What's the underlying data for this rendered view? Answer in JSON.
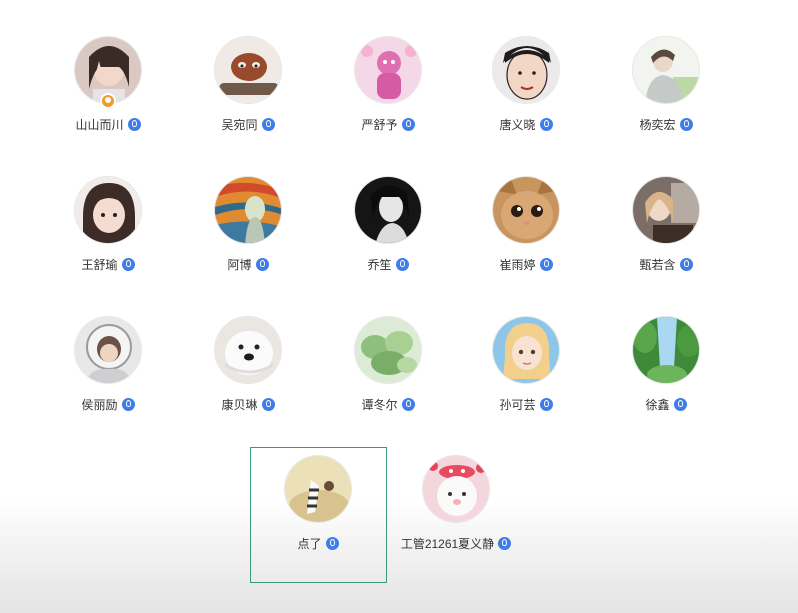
{
  "members": [
    {
      "name": "山山而川",
      "badge": true
    },
    {
      "name": "吴宛同",
      "badge": false
    },
    {
      "name": "严舒予",
      "badge": false
    },
    {
      "name": "唐义晓",
      "badge": false
    },
    {
      "name": "杨奕宏",
      "badge": false
    },
    {
      "name": "王舒瑜",
      "badge": false
    },
    {
      "name": "阿博",
      "badge": false
    },
    {
      "name": "乔笙",
      "badge": false
    },
    {
      "name": "崔雨婷",
      "badge": false
    },
    {
      "name": "甄若含",
      "badge": false
    },
    {
      "name": "侯丽励",
      "badge": false
    },
    {
      "name": "康贝琳",
      "badge": false
    },
    {
      "name": "谭冬尔",
      "badge": false
    },
    {
      "name": "孙可芸",
      "badge": false
    },
    {
      "name": "徐鑫",
      "badge": false
    },
    {
      "name": "点了",
      "badge": false,
      "selected": true
    },
    {
      "name": "工管21261夏义静",
      "badge": false
    }
  ],
  "icons": {
    "verified": "verified-badge-icon",
    "host": "host-badge-icon"
  },
  "colors": {
    "verified": "#3f7ee8",
    "selection_border": "#3a9a7a",
    "host_badge": "#f39a2c"
  }
}
